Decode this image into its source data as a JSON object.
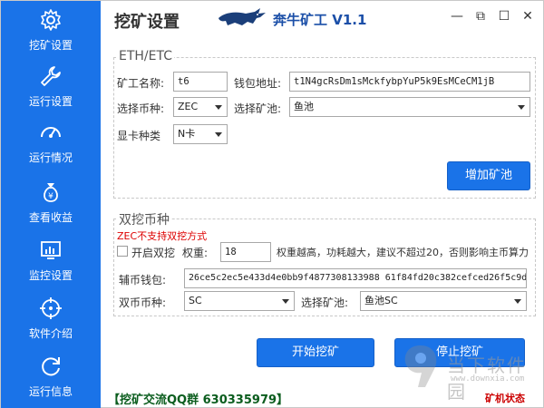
{
  "app": {
    "title": "挖矿设置",
    "brand_name": "奔牛矿工 V1.1",
    "window_buttons": [
      "—",
      "⧉",
      "☐",
      "✕"
    ]
  },
  "sidebar": {
    "items": [
      {
        "label": "挖矿设置",
        "icon": "gear-icon"
      },
      {
        "label": "运行设置",
        "icon": "wrench-icon"
      },
      {
        "label": "运行情况",
        "icon": "gauge-icon"
      },
      {
        "label": "查看收益",
        "icon": "money-bag-icon"
      },
      {
        "label": "监控设置",
        "icon": "monitor-chart-icon"
      },
      {
        "label": "软件介绍",
        "icon": "crosshair-icon"
      },
      {
        "label": "运行信息",
        "icon": "refresh-icon"
      }
    ]
  },
  "eth_group": {
    "title": "ETH/ETC",
    "miner_name_label": "矿工名称:",
    "miner_name_value": "t6",
    "wallet_label": "钱包地址:",
    "wallet_value": "t1N4gcRsDm1sMckfybpYuP5k9EsMCeCM1jB",
    "coin_label": "选择币种:",
    "coin_value": "ZEC",
    "pool_label": "选择矿池:",
    "pool_value": "鱼池",
    "gpu_label": "显卡种类",
    "gpu_value": "N卡",
    "add_pool_button": "增加矿池"
  },
  "dual_group": {
    "title": "双挖币种",
    "warning": "ZEC不支持双挖方式",
    "enable_label": "开启双挖",
    "weight_label": "权重:",
    "weight_value": "18",
    "hint": "权重越高，功耗越大，建议不超过20，否则影响主币算力",
    "aux_wallet_label": "辅币钱包:",
    "aux_wallet_value": "26ce5c2ec5e433d4e0bb9f4877308133988 61f84fd20c382cefced26f5c9da2812",
    "dual_coin_label": "双币币种:",
    "dual_coin_value": "SC",
    "dual_pool_label": "选择矿池:",
    "dual_pool_value": "鱼池SC"
  },
  "actions": {
    "start": "开始挖矿",
    "stop": "停止挖矿"
  },
  "footer": {
    "qq_group": "【挖矿交流QQ群 630335979】",
    "miner_status": "矿机状态"
  },
  "watermark": {
    "text": "当下软件园",
    "url": "www.downxia.com"
  },
  "colors": {
    "sidebar": "#1a73e8",
    "button": "#1a73e8",
    "warning": "#dd0000",
    "footer_left": "#0b5d1e",
    "footer_right": "#cc0000"
  }
}
